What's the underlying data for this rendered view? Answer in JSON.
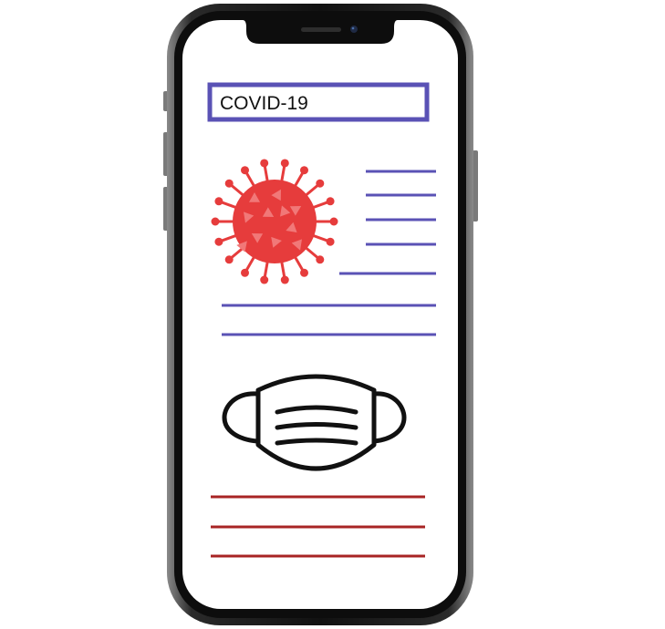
{
  "screen": {
    "title_text": "COVID-19"
  },
  "colors": {
    "accent": "#5a52b5",
    "virus": "#e63c3c",
    "virus_highlight": "#f17878",
    "lines_bottom": "#a82424",
    "mask_stroke": "#111111",
    "phone_frame": "#1b1b1b"
  },
  "icons": {
    "virus": "coronavirus-icon",
    "mask": "face-mask-icon",
    "camera": "camera-icon",
    "speaker": "speaker-icon"
  }
}
